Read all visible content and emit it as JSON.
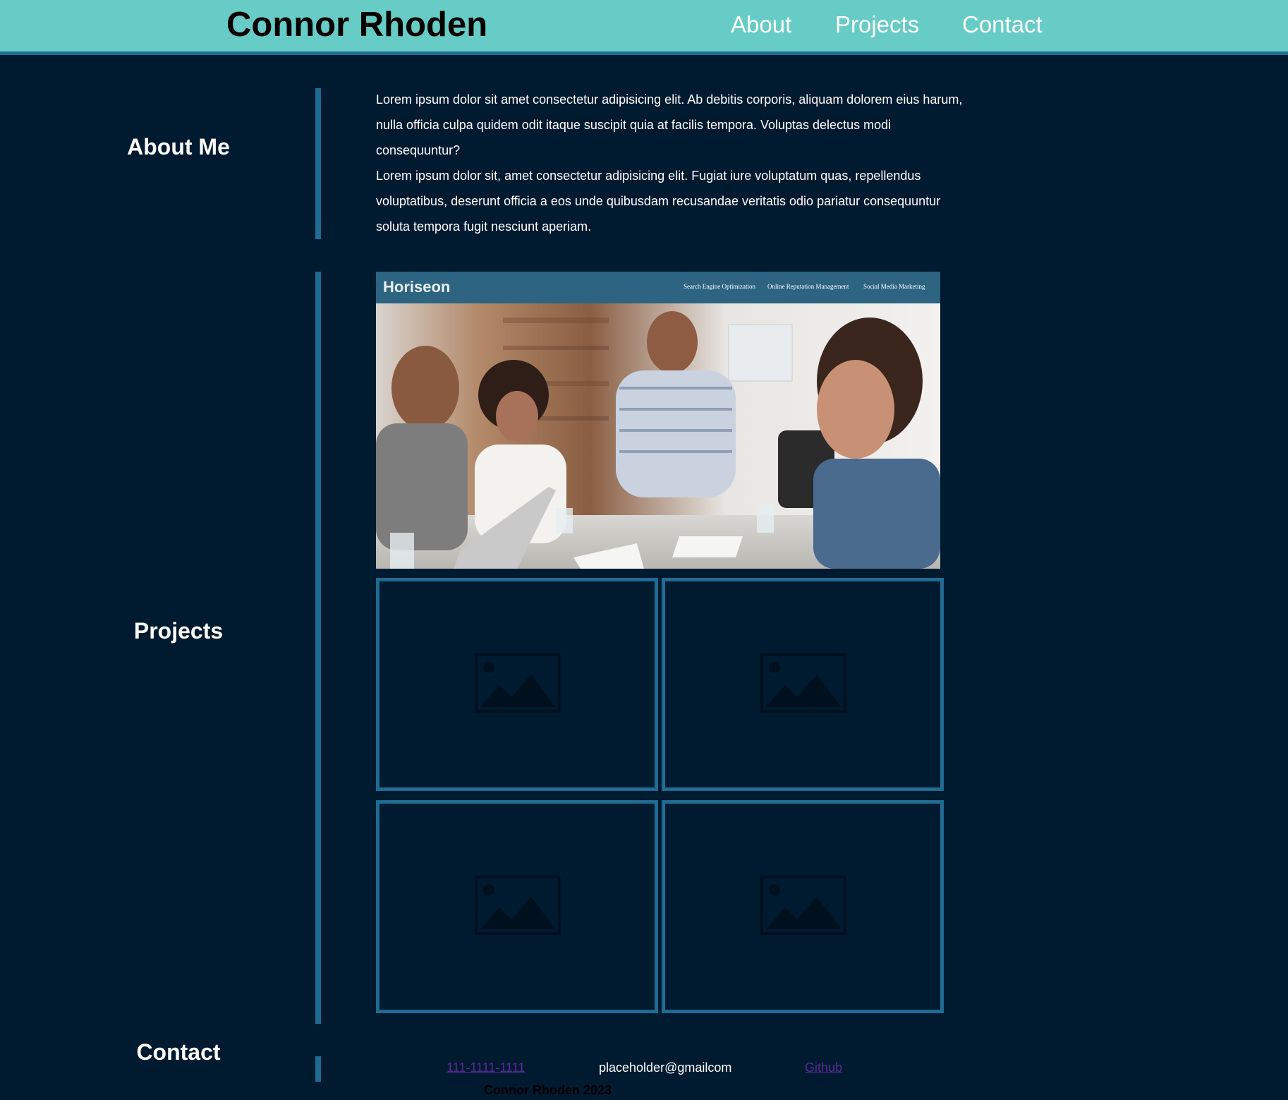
{
  "header": {
    "title": "Connor Rhoden",
    "nav": {
      "about": "About",
      "projects": "Projects",
      "contact": "Contact"
    }
  },
  "about": {
    "heading": "About Me",
    "paragraph1": "Lorem ipsum dolor sit amet consectetur adipisicing elit. Ab debitis corporis, aliquam dolorem eius harum, nulla officia culpa quidem odit itaque suscipit quia at facilis tempora. Voluptas delectus modi consequuntur?",
    "paragraph2": "Lorem ipsum dolor sit, amet consectetur adipisicing elit. Fugiat iure voluptatum quas, repellendus voluptatibus, deserunt officia a eos unde quibusdam recusandae veritatis odio pariatur consequuntur soluta tempora fugit nesciunt aperiam."
  },
  "projects": {
    "heading": "Projects",
    "featured": {
      "brand": "Horiseon",
      "nav": [
        "Search Engine Optimization",
        "Online Reputation Management",
        "Social Media Marketing"
      ]
    },
    "placeholder_icon": "image-placeholder-icon"
  },
  "contact": {
    "heading": "Contact",
    "phone": "111-1111-1111",
    "email": "placeholder@gmailcom",
    "github": "Github"
  },
  "footer": {
    "text": "Connor Rhoden 2023"
  },
  "colors": {
    "header_bg": "#66ccc5",
    "page_bg": "#001a30",
    "accent": "#1f6b92",
    "link_visited": "#5b2a96"
  }
}
